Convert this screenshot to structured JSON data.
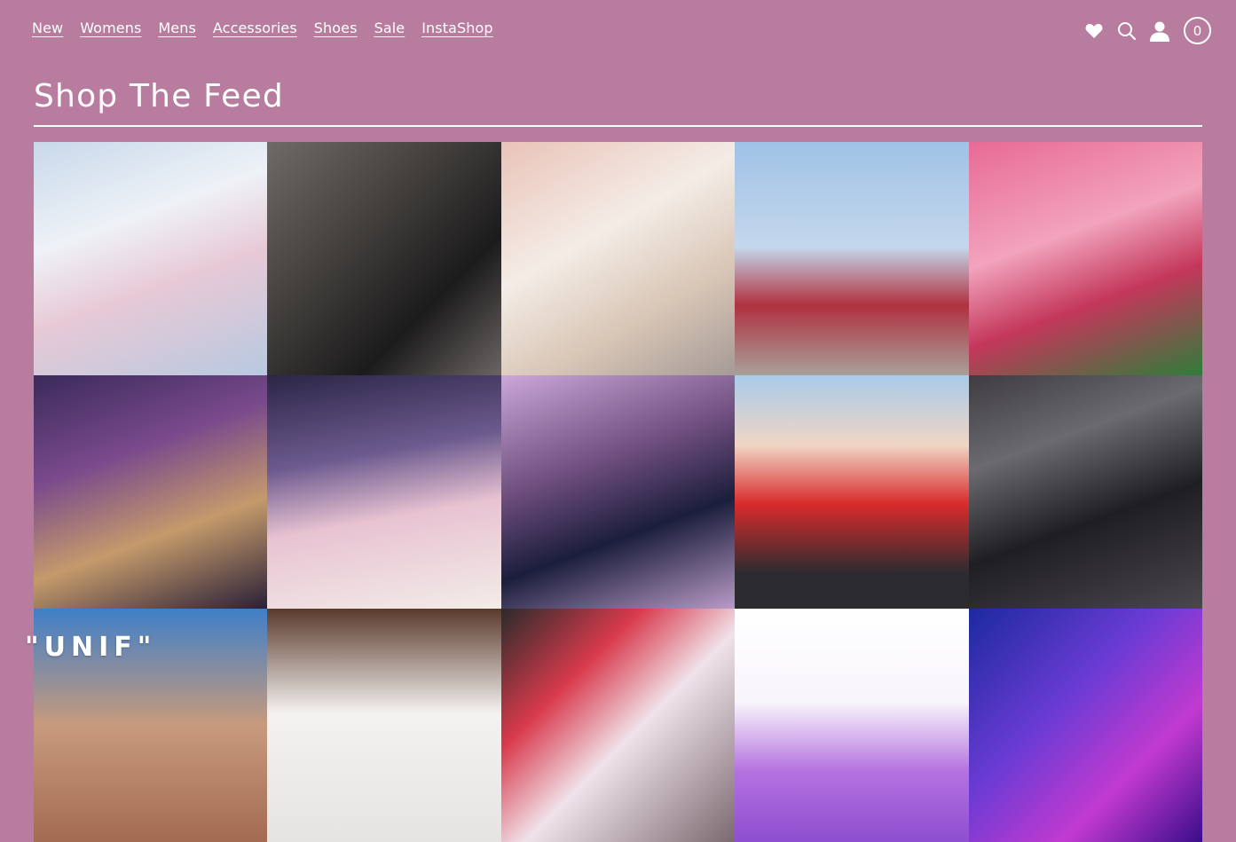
{
  "nav": {
    "items": [
      {
        "label": "New"
      },
      {
        "label": "Womens"
      },
      {
        "label": "Mens"
      },
      {
        "label": "Accessories"
      },
      {
        "label": "Shoes"
      },
      {
        "label": "Sale"
      },
      {
        "label": "InstaShop"
      }
    ]
  },
  "header": {
    "icons": [
      "heart-icon",
      "search-icon",
      "account-icon"
    ],
    "cart_count": "0"
  },
  "page": {
    "title": "Shop The Feed"
  },
  "brand": {
    "logo_text": "\"UNIF\""
  },
  "colors": {
    "background": "#b87c9f",
    "text": "#ffffff"
  },
  "feed": {
    "tiles": [
      {
        "bg": "linear-gradient(160deg,#c8d8ea 0%,#eef2f7 35%,#e7c9d6 60%,#b8c9e0 100%)"
      },
      {
        "bg": "linear-gradient(135deg,#6e6a66 0%,#3b3836 45%,#1c1b1c 70%,#6a6563 100%)"
      },
      {
        "bg": "linear-gradient(150deg,#e9c3b8 0%,#f4ece6 40%,#d8c6b6 70%,#a59a96 100%)"
      },
      {
        "bg": "linear-gradient(180deg,#9fc2e6 0%,#c4d7ec 45%,#b0313f 70%,#a7a099 100%)"
      },
      {
        "bg": "linear-gradient(160deg,#e86a95 0%,#f2a3bd 40%,#c4375b 65%,#2f7d3a 100%)"
      },
      {
        "bg": "linear-gradient(160deg,#3a2a5a 0%,#7a4a8c 35%,#c49a6b 65%,#2a2038 100%)"
      },
      {
        "bg": "linear-gradient(170deg,#2b2646 0%,#6c5a8e 35%,#e8c3d2 60%,#f2ece8 100%)"
      },
      {
        "bg": "linear-gradient(160deg,#caa7d8 0%,#6a4b7a 40%,#1b1e3c 65%,#b89ac6 100%)"
      },
      {
        "bg": "linear-gradient(180deg,#a9cbe9 0%,#f0d5c5 30%,#d92b2b 55%,#2c2b30 85%)"
      },
      {
        "bg": "linear-gradient(160deg,#3e3c40 0%,#6b6a70 30%,#1f1e22 60%,#4a474d 100%)"
      },
      {
        "bg": "linear-gradient(180deg,#3f7fc8 0%,#c89a7c 50%,#a36b50 100%)"
      },
      {
        "bg": "linear-gradient(180deg,#5a3a2c 0%,#f4f2f0 45%,#e6e4e2 100%)"
      },
      {
        "bg": "linear-gradient(135deg,#2b2b2b 0%,#d83a4b 30%,#f0e2ea 55%,#7a6a70 100%)"
      },
      {
        "bg": "linear-gradient(180deg,#ffffff 0%,#f8f5fb 40%,#b471e0 70%,#8e4fd0 100%)"
      },
      {
        "bg": "linear-gradient(135deg,#1c2a9e 0%,#6a3bd4 40%,#c23ad0 70%,#3a0d8a 100%)"
      }
    ]
  }
}
